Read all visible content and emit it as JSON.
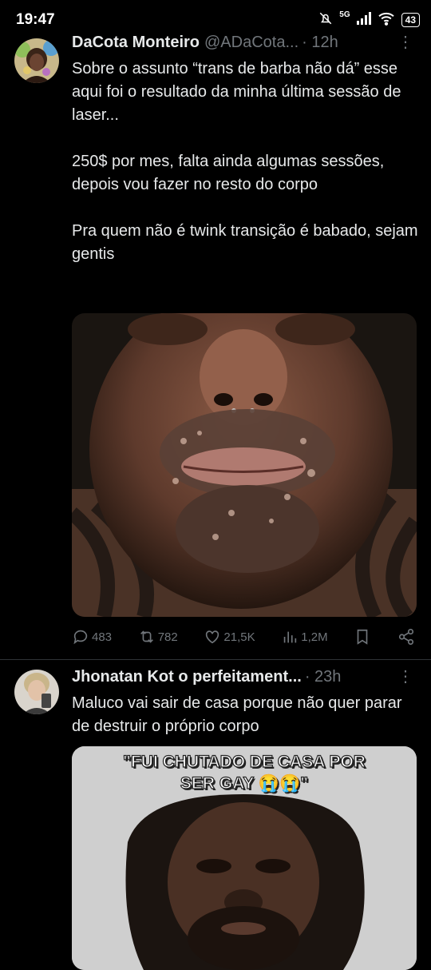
{
  "status_bar": {
    "time": "19:47",
    "network": "5G",
    "battery": "43"
  },
  "tweets": [
    {
      "name": "DaCota Monteiro",
      "handle": "@ADaCota...",
      "time": "· 12h",
      "text": "Sobre o assunto “trans de barba não dá” esse aqui foi o resultado da minha última sessão de laser...\n\n250$ por mes, falta ainda algumas sessões, depois vou fazer no resto do corpo\n\nPra quem não é twink transição é babado, sejam gentis",
      "replies": "483",
      "retweets": "782",
      "likes": "21,5K",
      "views": "1,2M"
    },
    {
      "name": "Jhonatan Kot o perfeitament...",
      "time": "· 23h",
      "text": "Maluco vai sair de casa porque não quer parar de destruir o próprio corpo",
      "image_caption": "\"FUI CHUTADO DE CASA POR SER GAY 😭😭\""
    }
  ]
}
